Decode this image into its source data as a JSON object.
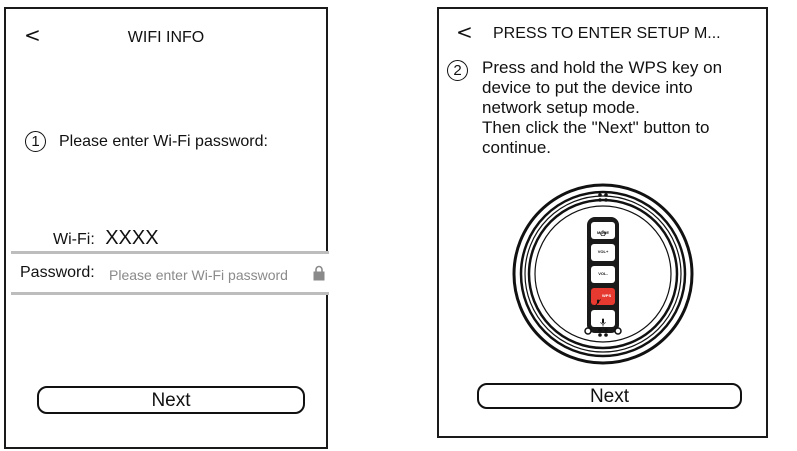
{
  "screen1": {
    "back_glyph": "<",
    "title": "WIFI INFO",
    "step_number": "1",
    "instruction": "Please enter Wi-Fi password:",
    "wifi_label": "Wi-Fi:",
    "wifi_ssid": "XXXX",
    "password_label": "Password:",
    "password_placeholder": "Please enter Wi-Fi password",
    "password_icon": "lock-icon",
    "next_label": "Next"
  },
  "screen2": {
    "back_glyph": "<",
    "title": "PRESS TO ENTER SETUP M...",
    "step_number": "2",
    "instruction_lines": [
      "Press and hold the WPS key on",
      "device to put the device into",
      "network setup mode.",
      "Then click the \"Next\" button to",
      "continue."
    ],
    "device": {
      "buttons": [
        {
          "label": "MODE",
          "icon": "power-icon"
        },
        {
          "label": "VOL+",
          "icon": ""
        },
        {
          "label": "VOL-",
          "icon": ""
        },
        {
          "label": "WPS",
          "icon": "mic-mute-icon",
          "highlight_color": "#e6392f"
        },
        {
          "label": "",
          "icon": "mic-icon"
        }
      ]
    },
    "next_label": "Next"
  }
}
